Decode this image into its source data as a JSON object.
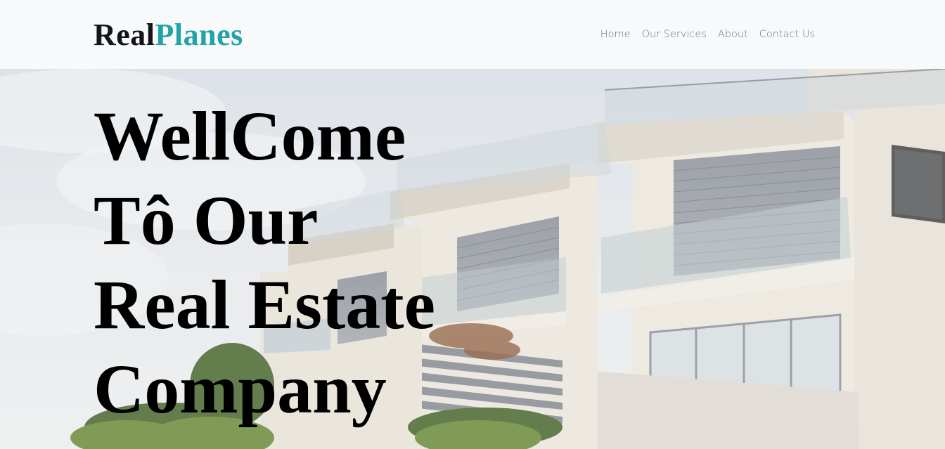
{
  "brand": {
    "part1": "Real",
    "part2": "Planes"
  },
  "nav": {
    "items": [
      {
        "label": "Home"
      },
      {
        "label": "Our Services"
      },
      {
        "label": "About"
      },
      {
        "label": "Contact Us"
      }
    ]
  },
  "hero": {
    "title_lines": [
      "WellCome",
      "Tô Our",
      "Real Estate",
      "Company"
    ]
  },
  "colors": {
    "brand_dark": "#14151a",
    "brand_accent": "#22a4a6",
    "nav_text": "#6e7074",
    "navbar_bg": "#f8f9fb"
  }
}
